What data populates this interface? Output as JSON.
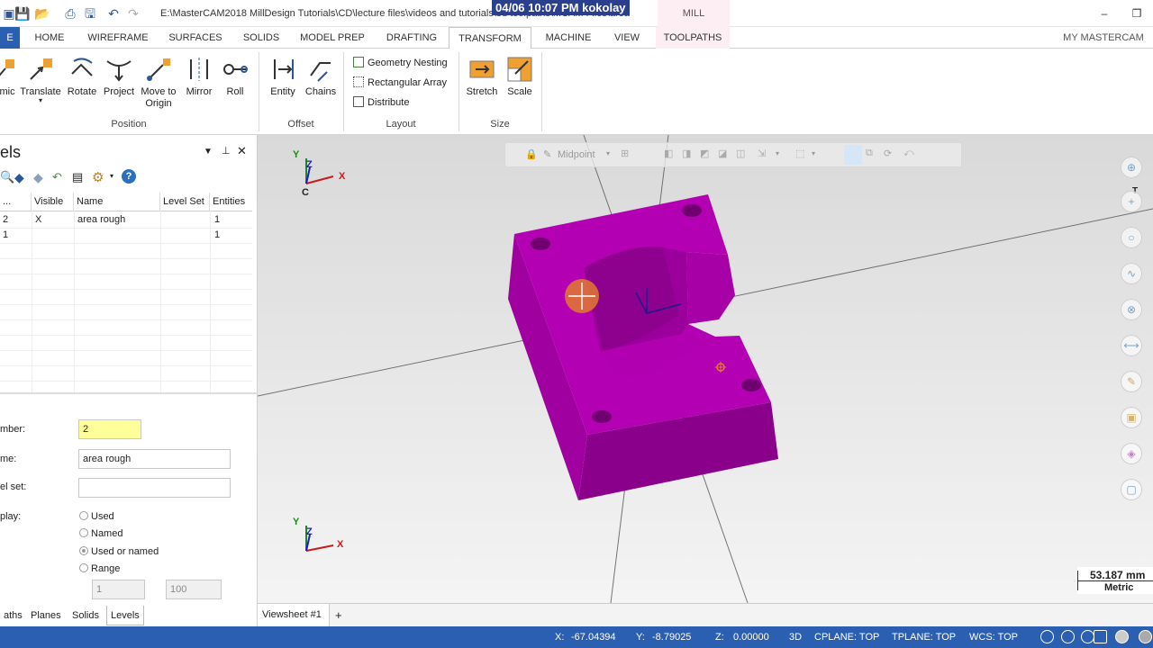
{
  "window": {
    "title_path": "E:\\MasterCAM2018 MillDesign Tutorials\\CD\\lecture files\\videos and tutorials\\3d toolpaths\\MCAM Files\\area",
    "timestamp_overlay": "04/06  10:07 PM  kokolay",
    "context_tab": "MILL"
  },
  "tabs": [
    "E",
    "HOME",
    "WIREFRAME",
    "SURFACES",
    "SOLIDS",
    "MODEL PREP",
    "DRAFTING",
    "TRANSFORM",
    "MACHINE",
    "VIEW",
    "TOOLPATHS"
  ],
  "account": "MY MASTERCAM",
  "ribbon": {
    "position": {
      "label": "Position",
      "buttons": [
        "amic",
        "Translate",
        "Rotate",
        "Project",
        "Move to Origin",
        "Mirror",
        "Roll"
      ]
    },
    "offset": {
      "label": "Offset",
      "buttons": [
        "Entity",
        "Chains"
      ]
    },
    "layout": {
      "label": "Layout",
      "buttons": [
        "Geometry Nesting",
        "Rectangular Array",
        "Distribute"
      ]
    },
    "size": {
      "label": "Size",
      "buttons": [
        "Stretch",
        "Scale"
      ]
    }
  },
  "levels_panel": {
    "title": "els",
    "columns": [
      "...",
      "Visible",
      "Name",
      "Level Set",
      "Entities"
    ],
    "rows": [
      {
        "num": "2",
        "visible": "X",
        "name": "area rough",
        "set": "",
        "entities": "1"
      },
      {
        "num": "1",
        "visible": "",
        "name": "",
        "set": "",
        "entities": "1"
      }
    ],
    "form": {
      "number_label": "mber:",
      "number_value": "2",
      "name_label": "me:",
      "name_value": "area rough",
      "levelset_label": "el set:",
      "levelset_value": "",
      "display_label": "play:",
      "options": [
        "Used",
        "Named",
        "Used or named",
        "Range"
      ],
      "selected_option": "Used or named",
      "range_from": "1",
      "range_to": "100"
    },
    "bottom_tabs": [
      "aths",
      "Planes",
      "Solids",
      "Levels"
    ],
    "active_bottom_tab": "Levels"
  },
  "viewport": {
    "toolbar_hint": "Midpoint",
    "top_triad": {
      "y": "Y",
      "z": "Z",
      "x": "X",
      "label": "C"
    },
    "bottom_triad": {
      "y": "Y",
      "z": "Z",
      "x": "X"
    },
    "right_triad": {
      "label": "T"
    },
    "scale": {
      "value": "53.187 mm",
      "unit": "Metric"
    },
    "model_color": "#b300b3",
    "cursor_color": "#e07a2c"
  },
  "viewsheet": {
    "tab": "Viewsheet #1",
    "add": "+"
  },
  "status": {
    "x_label": "X:",
    "x": "-67.04394",
    "y_label": "Y:",
    "y": "-8.79025",
    "z_label": "Z:",
    "z": "0.00000",
    "mode": "3D",
    "cplane": "CPLANE: TOP",
    "tplane": "TPLANE: TOP",
    "wcs": "WCS: TOP"
  }
}
